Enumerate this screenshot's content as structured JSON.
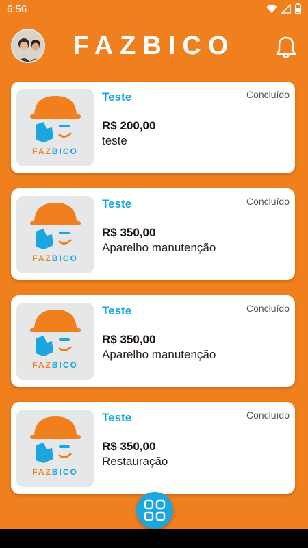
{
  "status_bar": {
    "time": "6:56"
  },
  "header": {
    "title": "FAZBICO"
  },
  "logo": {
    "part1": "FAZ",
    "part2": "BICO"
  },
  "cards": [
    {
      "title": "Teste",
      "status": "Concluído",
      "price": "R$ 200,00",
      "description": "teste"
    },
    {
      "title": "Teste",
      "status": "Concluído",
      "price": "R$ 350,00",
      "description": "Aparelho manutenção"
    },
    {
      "title": "Teste",
      "status": "Concluído",
      "price": "R$ 350,00",
      "description": "Aparelho manutenção"
    },
    {
      "title": "Teste",
      "status": "Concluído",
      "price": "R$ 350,00",
      "description": "Restauração"
    }
  ],
  "colors": {
    "background": "#F07F1E",
    "accent": "#1BA6DF",
    "card": "#FFFFFF"
  },
  "icons": [
    "wifi-icon",
    "signal-icon",
    "battery-icon",
    "bell-icon",
    "grid-menu-icon",
    "avatar"
  ]
}
